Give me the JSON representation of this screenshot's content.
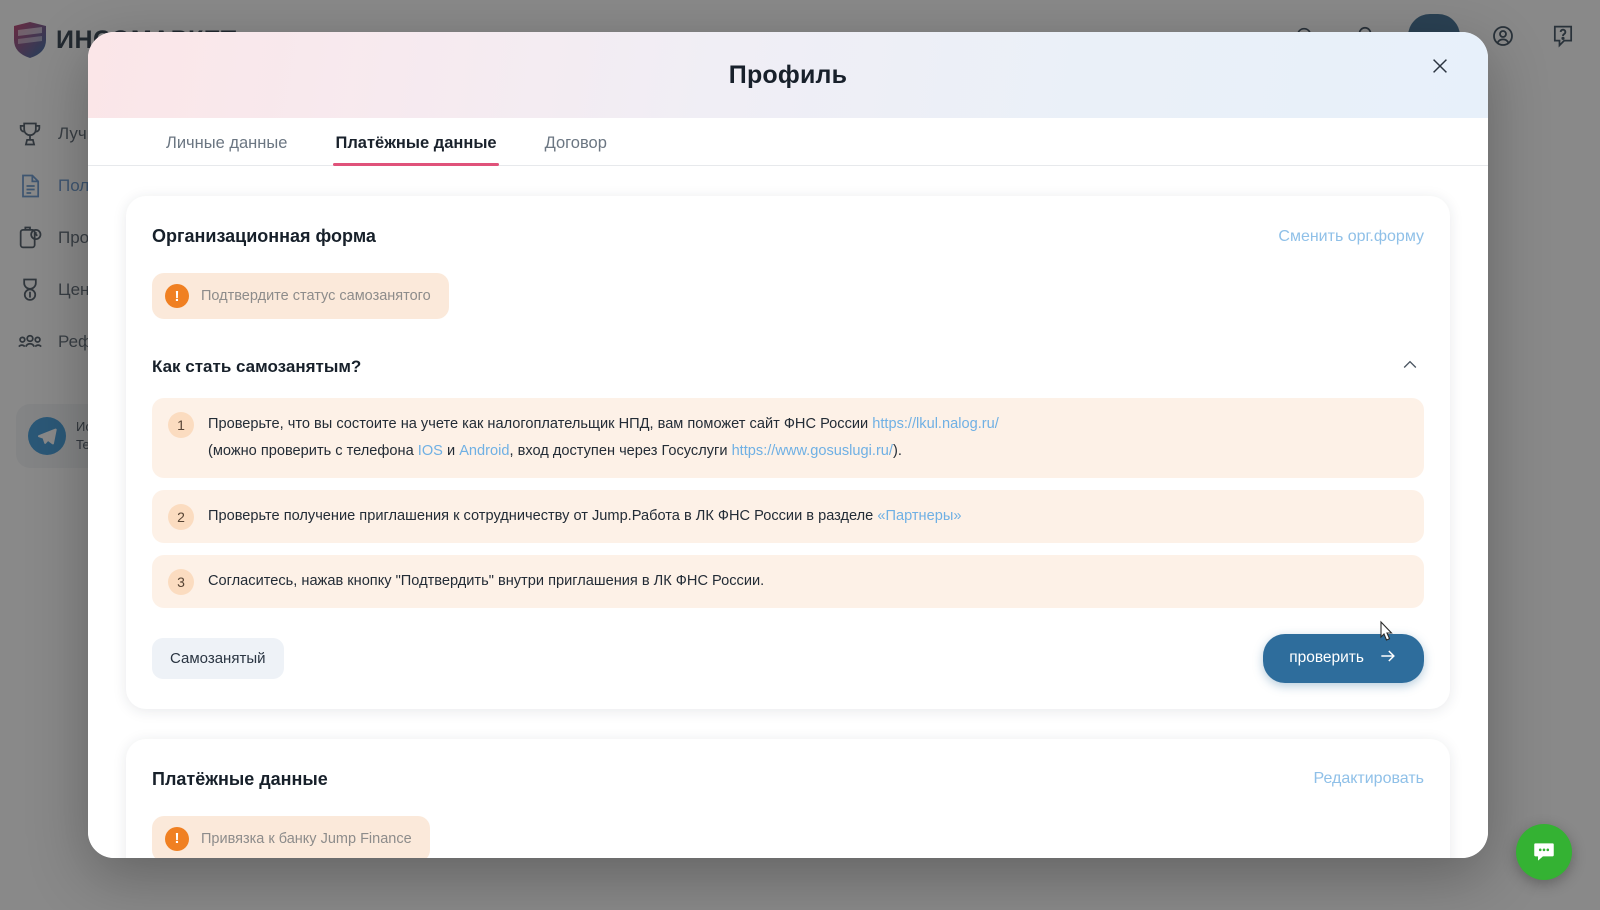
{
  "app": {
    "brand_name": "ИНСОМАРКЕТ",
    "topbar": {
      "help_icon": "question-circle-icon",
      "search_icon": "search-icon",
      "bell_icon": "bell-icon",
      "account_icon": "user-circle-icon",
      "primary_button": ""
    },
    "sidebar": {
      "items": [
        {
          "label": "Лучш",
          "icon": "trophy-icon",
          "active": false
        },
        {
          "label": "Поли",
          "icon": "document-icon",
          "active": true
        },
        {
          "label": "Про.",
          "icon": "clipboard-clock-icon",
          "active": false
        },
        {
          "label": "Цент",
          "icon": "medal-icon",
          "active": false
        },
        {
          "label": "Реф.",
          "icon": "people-icon",
          "active": false
        }
      ],
      "telegram_card": {
        "icon": "telegram-icon",
        "line1": "Ис",
        "line2": "Tele"
      }
    },
    "chat_fab_icon": "chat-bubble-icon"
  },
  "modal": {
    "title": "Профиль",
    "close_icon": "close-icon",
    "tabs": [
      {
        "label": "Личные данные",
        "active": false
      },
      {
        "label": "Платёжные данные",
        "active": true
      },
      {
        "label": "Договор",
        "active": false
      }
    ],
    "org_card": {
      "title": "Организационная форма",
      "change_link": "Сменить орг.форму",
      "warning": {
        "icon": "alert-icon",
        "text": "Подтвердите статус самозанятого"
      },
      "accordion": {
        "title": "Как стать самозанятым?",
        "chevron_icon": "chevron-up-icon",
        "expanded": true,
        "steps": [
          {
            "num": "1",
            "parts": [
              {
                "type": "text",
                "value": "Проверьте, что вы состоите на учете как налогоплательщик НПД, вам поможет сайт ФНС России "
              },
              {
                "type": "link",
                "value": "https://lkul.nalog.ru/"
              },
              {
                "type": "br",
                "value": ""
              },
              {
                "type": "text",
                "value": "(можно проверить с телефона "
              },
              {
                "type": "link",
                "value": "IOS"
              },
              {
                "type": "text",
                "value": " и "
              },
              {
                "type": "link",
                "value": "Android"
              },
              {
                "type": "text",
                "value": ", вход доступен через Госуслуги "
              },
              {
                "type": "link",
                "value": "https://www.gosuslugi.ru/"
              },
              {
                "type": "text",
                "value": ")."
              }
            ]
          },
          {
            "num": "2",
            "parts": [
              {
                "type": "text",
                "value": "Проверьте получение приглашения к сотрудничеству от Jump.Работа в ЛК ФНС России в разделе "
              },
              {
                "type": "link",
                "value": "«Партнеры»"
              }
            ]
          },
          {
            "num": "3",
            "parts": [
              {
                "type": "text",
                "value": "Согласитесь, нажав кнопку \"Подтвердить\" внутри приглашения в ЛК ФНС России."
              }
            ]
          }
        ]
      },
      "status_tag": "Самозанятый",
      "check_button": {
        "label": "проверить",
        "icon": "arrow-right-icon"
      }
    },
    "payment_card": {
      "title": "Платёжные данные",
      "edit_link": "Редактировать",
      "warning": {
        "icon": "alert-icon",
        "text": "Привязка к банку Jump Finance"
      }
    }
  },
  "colors": {
    "accent_pink": "#e0527a",
    "link_blue": "#6fb0e4",
    "button_blue": "#2e6d9c",
    "warn_orange": "#f08022",
    "warn_bg": "#fbe9da",
    "step_bg": "#fdf1e7",
    "chat_green": "#34b233"
  }
}
